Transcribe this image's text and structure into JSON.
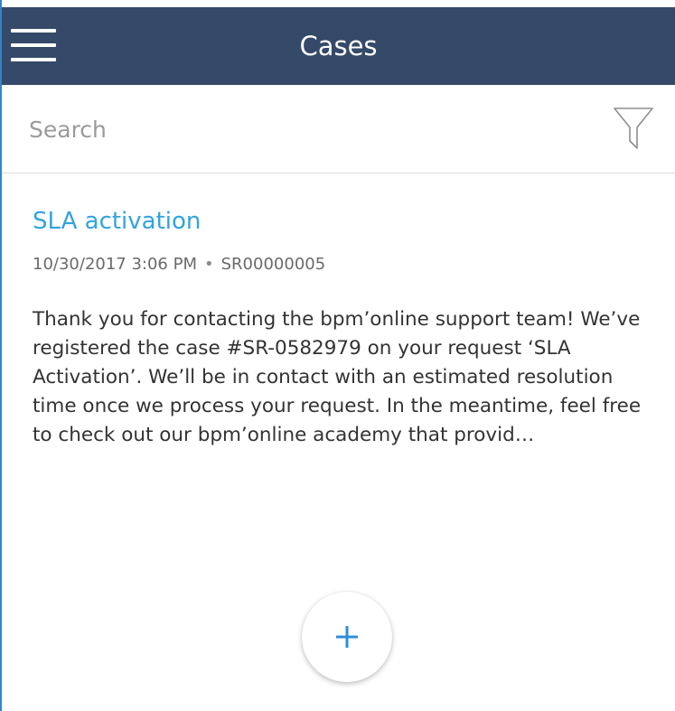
{
  "header": {
    "title": "Cases",
    "menu_icon": "hamburger-menu-icon",
    "background_color": "#354968"
  },
  "search": {
    "placeholder": "Search",
    "value": "",
    "filter_icon": "filter-funnel-icon"
  },
  "cases": [
    {
      "title": "SLA activation",
      "datetime": "10/30/2017 3:06 PM",
      "separator": "•",
      "number": "SR00000005",
      "body": "Thank you for contacting the bpm’online support team! We’ve registered the case #SR-0582979 on your request ‘SLA Activation’. We’ll be in contact with an estimated resolution time once we process your request. In the meantime, feel free to check out our bpm’online academy that provid…"
    }
  ],
  "fab": {
    "icon": "plus-icon",
    "accent_color": "#2e8fd8"
  },
  "colors": {
    "accent_link": "#33a3df",
    "left_border": "#2f86c9"
  }
}
